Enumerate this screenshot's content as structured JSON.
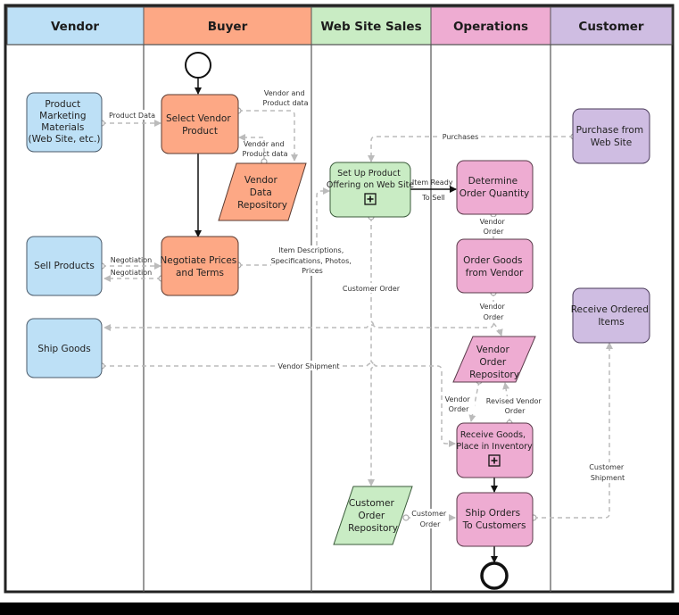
{
  "lanes": [
    {
      "id": "vendor",
      "title": "Vendor",
      "color": "#bde0f6"
    },
    {
      "id": "buyer",
      "title": "Buyer",
      "color": "#fda885"
    },
    {
      "id": "web",
      "title": "Web Site Sales",
      "color": "#c9ecc4"
    },
    {
      "id": "ops",
      "title": "Operations",
      "color": "#eeacd2"
    },
    {
      "id": "customer",
      "title": "Customer",
      "color": "#cfbde2"
    }
  ],
  "nodes": {
    "product_marketing": {
      "lines": [
        "Product",
        "Marketing",
        "Materials",
        "(Web Site, etc.)"
      ]
    },
    "sell_products": {
      "lines": [
        "Sell Products"
      ]
    },
    "ship_goods": {
      "lines": [
        "Ship Goods"
      ]
    },
    "select_vendor": {
      "lines": [
        "Select Vendor",
        "Product"
      ]
    },
    "vendor_repo": {
      "lines": [
        "Vendor",
        "Data",
        "Repository"
      ]
    },
    "negotiate": {
      "lines": [
        "Negotiate Prices",
        "and Terms"
      ]
    },
    "setup_offering": {
      "lines": [
        "Set Up Product",
        "Offering on Web Site"
      ]
    },
    "customer_repo": {
      "lines": [
        "Customer",
        "Order",
        "Repository"
      ]
    },
    "determine_qty": {
      "lines": [
        "Determine",
        "Order Quantity"
      ]
    },
    "order_goods": {
      "lines": [
        "Order Goods",
        "from Vendor"
      ]
    },
    "vendor_order_repo": {
      "lines": [
        "Vendor",
        "Order",
        "Repository"
      ]
    },
    "receive_goods": {
      "lines": [
        "Receive Goods,",
        "Place in Inventory"
      ]
    },
    "ship_orders": {
      "lines": [
        "Ship Orders",
        "To Customers"
      ]
    },
    "purchase_web": {
      "lines": [
        "Purchase from",
        "Web Site"
      ]
    },
    "receive_items": {
      "lines": [
        "Receive Ordered",
        "Items"
      ]
    }
  },
  "flows": {
    "product_data": [
      "Product Data"
    ],
    "vendor_product_data_1": [
      "Vendor and",
      "Product data"
    ],
    "vendor_product_data_2": [
      "Vendor and",
      "Product data"
    ],
    "negotiation_1": [
      "Negotiation"
    ],
    "negotiation_2": [
      "Negotiation"
    ],
    "item_descriptions": [
      "Item Descriptions,",
      "Specifications, Photos,",
      "Prices"
    ],
    "purchases": [
      "Purchases"
    ],
    "item_ready": [
      "Item Ready",
      "To Sell"
    ],
    "vendor_order_1": [
      "Vendor",
      "Order"
    ],
    "vendor_order_2": [
      "Vendor",
      "Order"
    ],
    "customer_order_1": [
      "Customer Order"
    ],
    "vendor_shipment": [
      "Vendor Shipment"
    ],
    "vendor_order_3": [
      "Vendor",
      "Order"
    ],
    "revised_vendor_order": [
      "Revised Vendor",
      "Order"
    ],
    "customer_order_2": [
      "Customer",
      "Order"
    ],
    "customer_shipment": [
      "Customer",
      "Shipment"
    ]
  }
}
